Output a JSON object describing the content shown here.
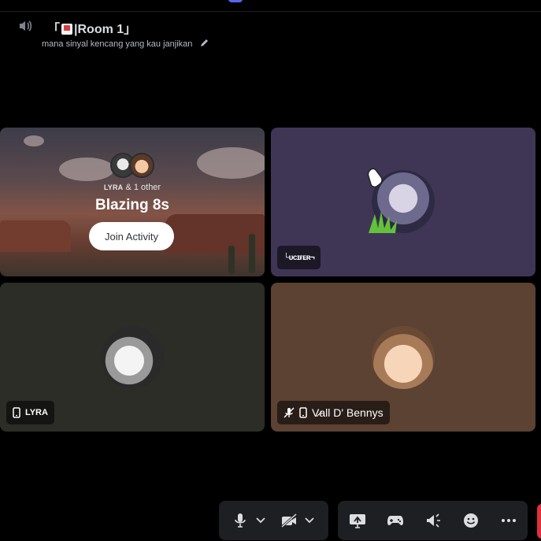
{
  "top_cut_text": "🔔 · □",
  "header": {
    "room_title": "「▌|Room 1」",
    "room_title_prefix": "「",
    "room_title_name": "|Room 1」",
    "status_text": "mana sinyal kencang yang kau janjikan"
  },
  "activity": {
    "participants_name": "LYRA",
    "participants_suffix": " & 1 other",
    "title": "Blazing 8s",
    "join_label": "Join Activity"
  },
  "tiles": [
    {
      "name": "Lʊᴄɪғᴇʀ¬"
    },
    {
      "name": "LYRA"
    },
    {
      "name": "Vall D' Bennys"
    }
  ],
  "tile_name_display": {
    "lucifer": "└ᴜᴄɪғᴇʀ¬",
    "lyra": "LYRA",
    "vall": "V̷all D' Bennys"
  },
  "colors": {
    "background": "#000000",
    "tile_purple": "#3f3656",
    "tile_olive": "#2d2d28",
    "tile_brown": "#5b4233",
    "control_bar": "#1e1f22",
    "end_call_red": "#e0303a"
  },
  "icons": {
    "speaker": "speaker-icon",
    "edit": "pencil-icon",
    "mic": "microphone-icon",
    "camera_off": "camera-off-icon",
    "screen_share": "screen-share-icon",
    "activity": "gamepad-icon",
    "soundboard": "soundboard-icon",
    "emoji": "emoji-icon",
    "more": "more-icon",
    "mobile": "mobile-icon",
    "muted": "mute-icon"
  }
}
